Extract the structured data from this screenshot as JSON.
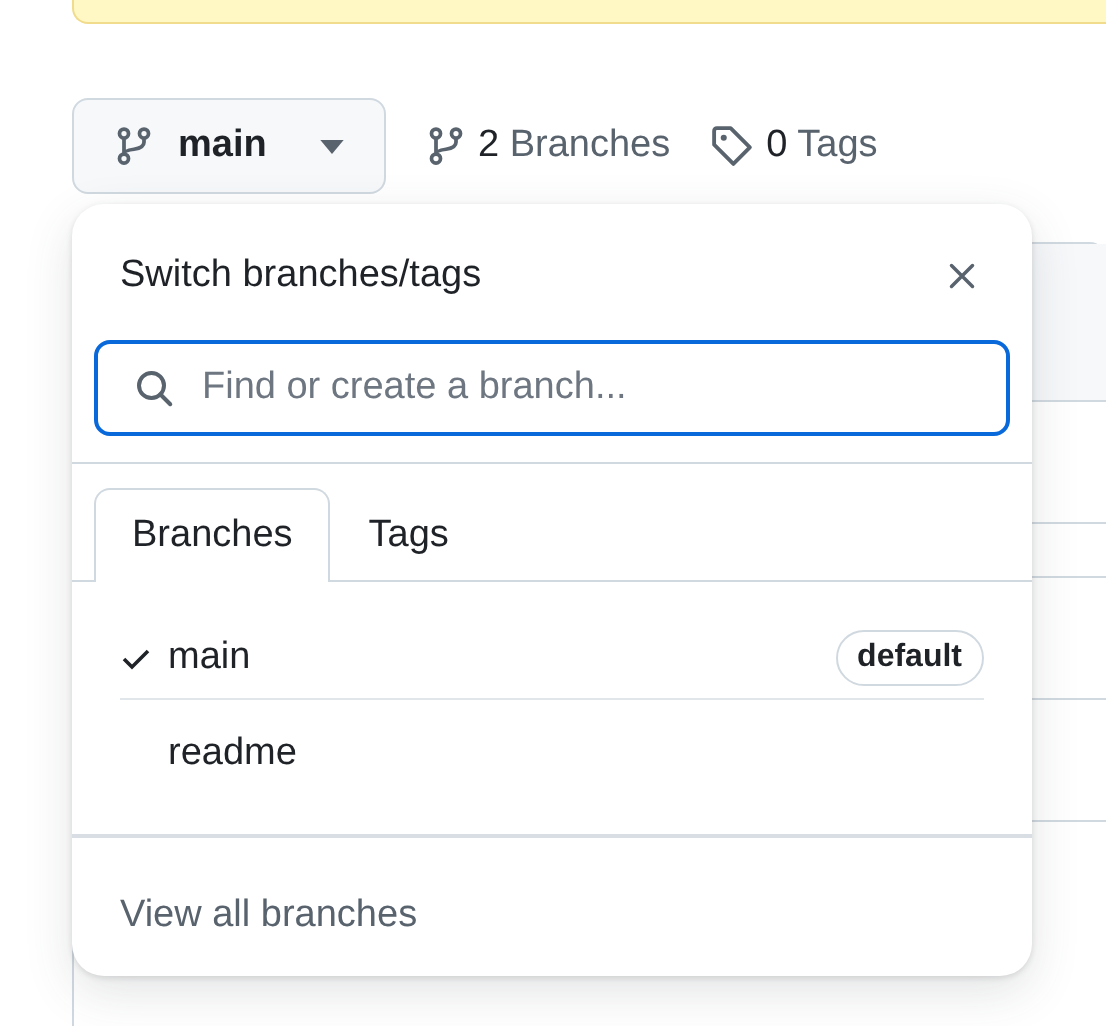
{
  "branch_button": {
    "label": "main"
  },
  "counts": [
    {
      "kind": "branch",
      "number": "2",
      "label": "Branches"
    },
    {
      "kind": "tag",
      "number": "0",
      "label": "Tags"
    }
  ],
  "popup": {
    "title": "Switch branches/tags",
    "search": {
      "placeholder": "Find or create a branch..."
    },
    "tabs": [
      {
        "label": "Branches",
        "selected": true
      },
      {
        "label": "Tags",
        "selected": false
      }
    ],
    "branches": [
      {
        "name": "main",
        "checked": true,
        "badge": "default"
      },
      {
        "name": "readme",
        "checked": false
      }
    ],
    "footer_link": "View all branches"
  }
}
